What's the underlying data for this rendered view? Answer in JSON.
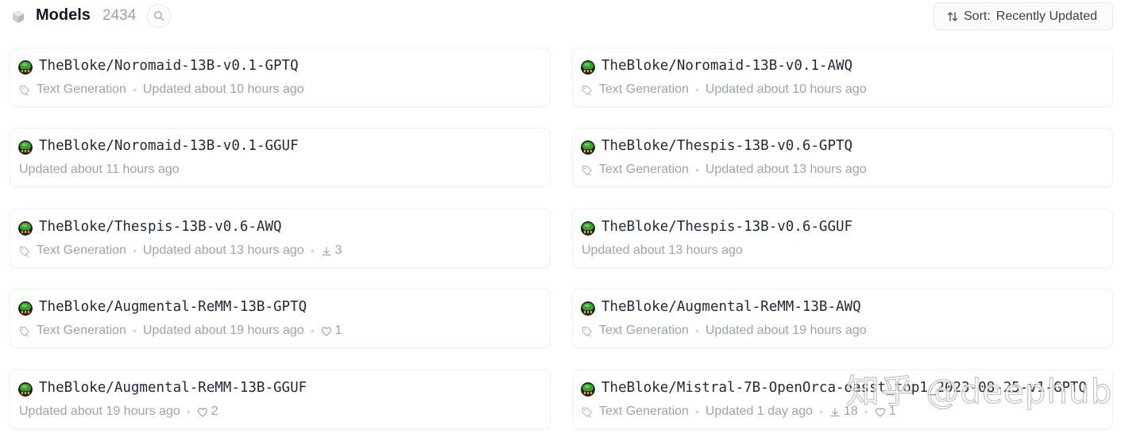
{
  "header": {
    "title": "Models",
    "count": "2434",
    "cube_icon": "cube-icon",
    "search_icon": "search-icon",
    "sort_label": "Sort:",
    "sort_value": "Recently Updated",
    "sort_icon": "sort-arrows-icon"
  },
  "models": [
    {
      "name": "TheBloke/Noromaid-13B-v0.1-GPTQ",
      "task": "Text Generation",
      "updated": "Updated about 10 hours ago",
      "downloads": "",
      "likes": ""
    },
    {
      "name": "TheBloke/Noromaid-13B-v0.1-AWQ",
      "task": "Text Generation",
      "updated": "Updated about 10 hours ago",
      "downloads": "",
      "likes": ""
    },
    {
      "name": "TheBloke/Noromaid-13B-v0.1-GGUF",
      "task": "",
      "updated": "Updated about 11 hours ago",
      "downloads": "",
      "likes": ""
    },
    {
      "name": "TheBloke/Thespis-13B-v0.6-GPTQ",
      "task": "Text Generation",
      "updated": "Updated about 13 hours ago",
      "downloads": "",
      "likes": ""
    },
    {
      "name": "TheBloke/Thespis-13B-v0.6-AWQ",
      "task": "Text Generation",
      "updated": "Updated about 13 hours ago",
      "downloads": "3",
      "likes": ""
    },
    {
      "name": "TheBloke/Thespis-13B-v0.6-GGUF",
      "task": "",
      "updated": "Updated about 13 hours ago",
      "downloads": "",
      "likes": ""
    },
    {
      "name": "TheBloke/Augmental-ReMM-13B-GPTQ",
      "task": "Text Generation",
      "updated": "Updated about 19 hours ago",
      "downloads": "",
      "likes": "1"
    },
    {
      "name": "TheBloke/Augmental-ReMM-13B-AWQ",
      "task": "Text Generation",
      "updated": "Updated about 19 hours ago",
      "downloads": "",
      "likes": ""
    },
    {
      "name": "TheBloke/Augmental-ReMM-13B-GGUF",
      "task": "",
      "updated": "Updated about 19 hours ago",
      "downloads": "",
      "likes": "2"
    },
    {
      "name": "TheBloke/Mistral-7B-OpenOrca-oasst_top1_2023-08-25-v1-GPTQ",
      "task": "Text Generation",
      "updated": "Updated 1 day ago",
      "downloads": "18",
      "likes": "1"
    }
  ],
  "watermark": "知乎 @deephub",
  "colors": {
    "text_muted": "#9ca3af",
    "card_border": "#f0f1f3",
    "avatar_green": "#2f8f2a"
  }
}
